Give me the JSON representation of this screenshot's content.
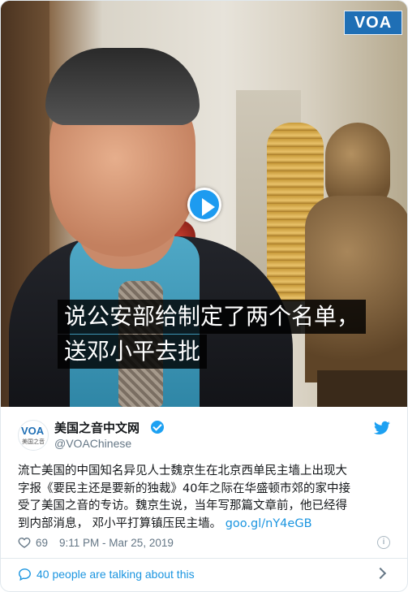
{
  "video": {
    "brand_logo": "VOA",
    "subtitle_line1": "说公安部给制定了两个名单，",
    "subtitle_line2": "送邓小平去批"
  },
  "author": {
    "avatar_text": "VOA",
    "avatar_subtext": "美国之音",
    "display_name": "美国之音中文网",
    "handle": "@VOAChinese"
  },
  "tweet": {
    "lines": [
      "流亡美国的中国知名异见人士魏京生在北京西单民主墙上出现大",
      "字报《要民主还是要新的独裁》40年之际在华盛顿市郊的家中接",
      "受了美国之音的专访。魏京生说，当年写那篇文章前，他已经得",
      "到内部消息， 邓小平打算镇压民主墙。 "
    ],
    "link": "goo.gl/nY4eGB",
    "like_count": "69",
    "timestamp": "9:11 PM - Mar 25, 2019"
  },
  "footer": {
    "talking": "40 people are talking about this"
  },
  "colors": {
    "twitter_blue": "#1da1f2",
    "link_blue": "#1b95e0",
    "voa_blue": "#1f6fb5"
  }
}
